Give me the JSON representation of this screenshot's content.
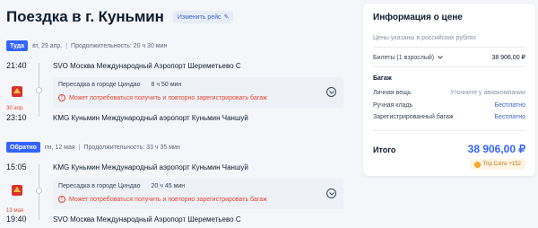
{
  "header": {
    "title": "Поездка в г. Куньмин",
    "change_label": "Изменить рейс"
  },
  "outbound": {
    "badge": "Туда",
    "date": "вт, 29 апр.",
    "duration": "Продолжительность: 20 ч 30 мин",
    "dep_time": "21:40",
    "dep_airport": "SVO Москва Международный Аэропорт Шереметьево C",
    "transfer": "Пересадка в городе Циндао",
    "transfer_dur": "8 ч 50 мин",
    "warning": "Может потребоваться получить и повторно зарегистрировать багаж",
    "arr_date_note": "30 апр.",
    "arr_time": "23:10",
    "arr_airport": "KMG Куньмин Международный аэропорт Куньмин Чаншуй"
  },
  "inbound": {
    "badge": "Обратно",
    "date": "пн, 12 мая",
    "duration": "Продолжительность: 33 ч 35 мин",
    "dep_time": "15:05",
    "dep_airport": "KMG Куньмин Международный аэропорт Куньмин Чаншуй",
    "transfer": "Пересадка в городе Циндао",
    "transfer_dur": "20 ч 45 мин",
    "warning": "Может потребоваться получить и повторно зарегистрировать багаж",
    "arr_date_note": "13 мая",
    "arr_time": "19:40",
    "arr_airport": "SVO Москва Международный Аэропорт Шереметьево C"
  },
  "price_card": {
    "title": "Информация о цене",
    "note": "Цены указаны в российских рублях",
    "tickets_label": "Билеты (1 взрослый)",
    "tickets_value": "38 906,00 ₽",
    "baggage_title": "Багаж",
    "baggage": [
      {
        "label": "Личная вещь",
        "value": "Уточните у авиакомпании"
      },
      {
        "label": "Ручная кладь",
        "value": "Бесплатно"
      },
      {
        "label": "Зарегистрированный багаж",
        "value": "Бесплатно"
      }
    ],
    "total_label": "Итого",
    "total_value": "38 906,00 ₽",
    "coins": "Trip Coins +152"
  },
  "colors": {
    "accent": "#3264ff",
    "warning": "#e2442f",
    "link": "#3f62c9"
  }
}
